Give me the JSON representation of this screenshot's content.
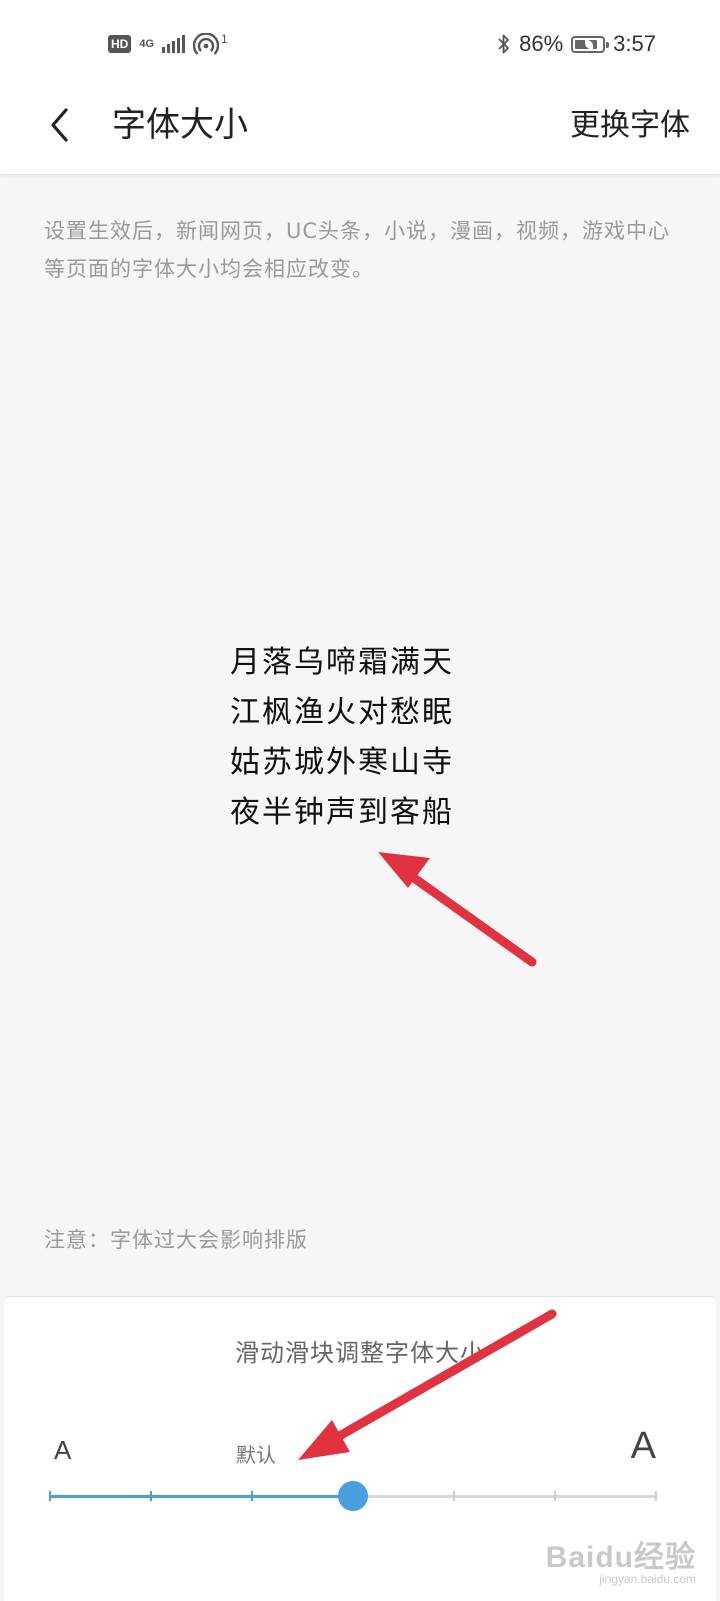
{
  "status_bar": {
    "hd_icon": "HD",
    "network_type": "4G",
    "hotspot_count": "1",
    "battery_percent": "86%",
    "battery_level": 0.86,
    "time": "3:57",
    "icons": [
      "hd-icon",
      "signal-icon",
      "hotspot-icon",
      "bluetooth-icon",
      "battery-icon"
    ]
  },
  "header": {
    "back_icon": "chevron-left-icon",
    "title": "字体大小",
    "change_font_label": "更换字体"
  },
  "description": "设置生效后，新闻网页，UC头条，小说，漫画，视频，游戏中心等页面的字体大小均会相应改变。",
  "poem_lines": [
    "月落乌啼霜满天",
    "江枫渔火对愁眠",
    "姑苏城外寒山寺",
    "夜半钟声到客船"
  ],
  "note": "注意：字体过大会影响排版",
  "slider": {
    "title": "滑动滑块调整字体大小",
    "small_label": "A",
    "large_label": "A",
    "default_label": "默认",
    "step_count": 7,
    "current_step": 3,
    "default_step": 3,
    "accent_color": "#4aa0df"
  },
  "annotation_color": "#e0323f",
  "watermark": {
    "logo": "Baidu经验",
    "url": "jingyan.baidu.com"
  }
}
